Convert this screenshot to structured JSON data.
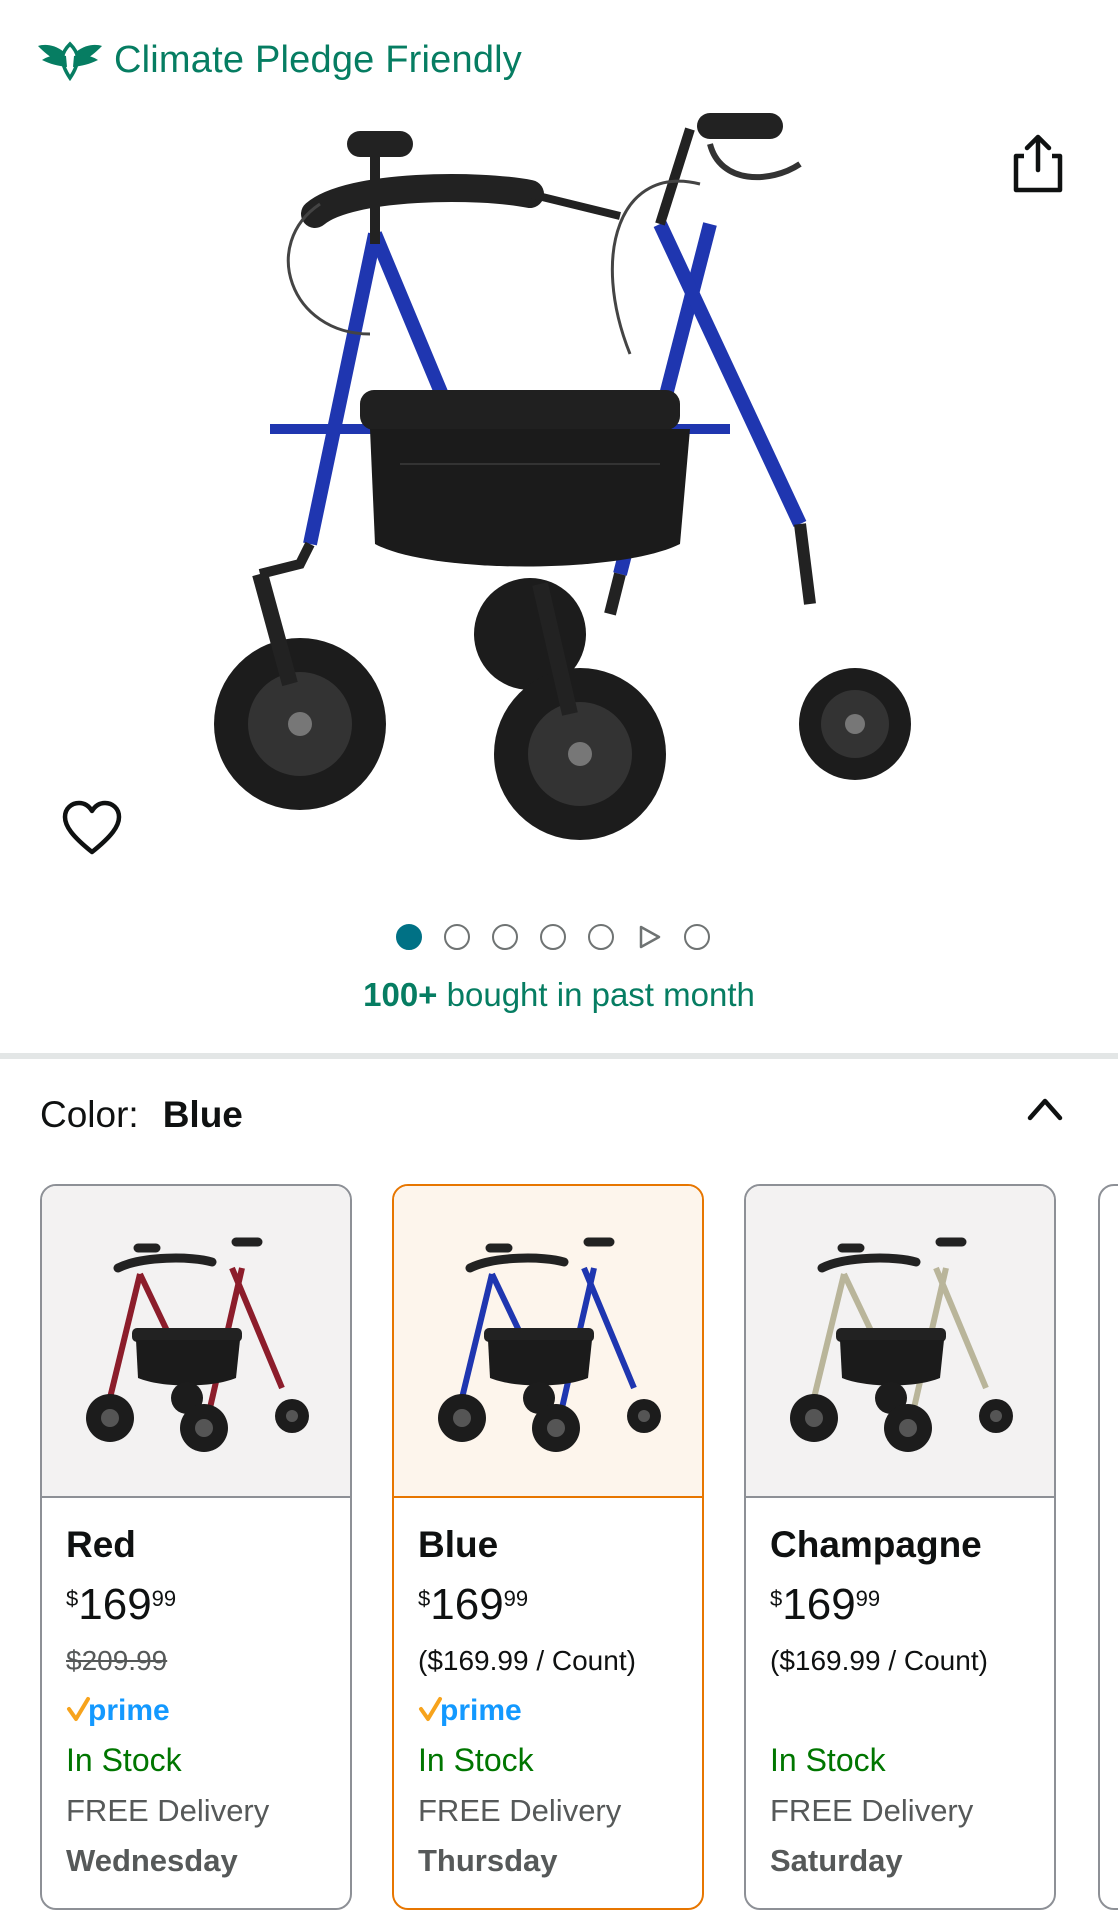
{
  "badge": {
    "text": "Climate Pledge Friendly",
    "icon": "leaf-wings-icon"
  },
  "header_icons": {
    "share": "share-icon",
    "favorite": "heart-icon"
  },
  "carousel": {
    "total": 7,
    "active_index": 0,
    "video_index": 5
  },
  "bought": {
    "count": "100+",
    "text": " bought in past month"
  },
  "color_selector": {
    "label": "Color:",
    "value": "Blue",
    "toggle_icon": "chevron-up-icon"
  },
  "colors": {
    "accent": "#067d62",
    "link": "#007185",
    "selected": "#e77600",
    "in_stock": "#007600",
    "prime": "#1399ff"
  },
  "variants": [
    {
      "name": "Red",
      "currency": "$",
      "whole": "169",
      "fraction": "99",
      "secondary": "$209.99",
      "prime": "prime",
      "stock": "In Stock",
      "delivery": "FREE Delivery",
      "day": "Wednesday"
    },
    {
      "name": "Blue",
      "currency": "$",
      "whole": "169",
      "fraction": "99",
      "secondary": "($169.99 / Count)",
      "prime": "prime",
      "stock": "In Stock",
      "delivery": "FREE Delivery",
      "day": "Thursday"
    },
    {
      "name": "Champagne",
      "currency": "$",
      "whole": "169",
      "fraction": "99",
      "secondary": "($169.99 / Count)",
      "stock": "In Stock",
      "delivery": "FREE Delivery",
      "day": "Saturday"
    }
  ]
}
